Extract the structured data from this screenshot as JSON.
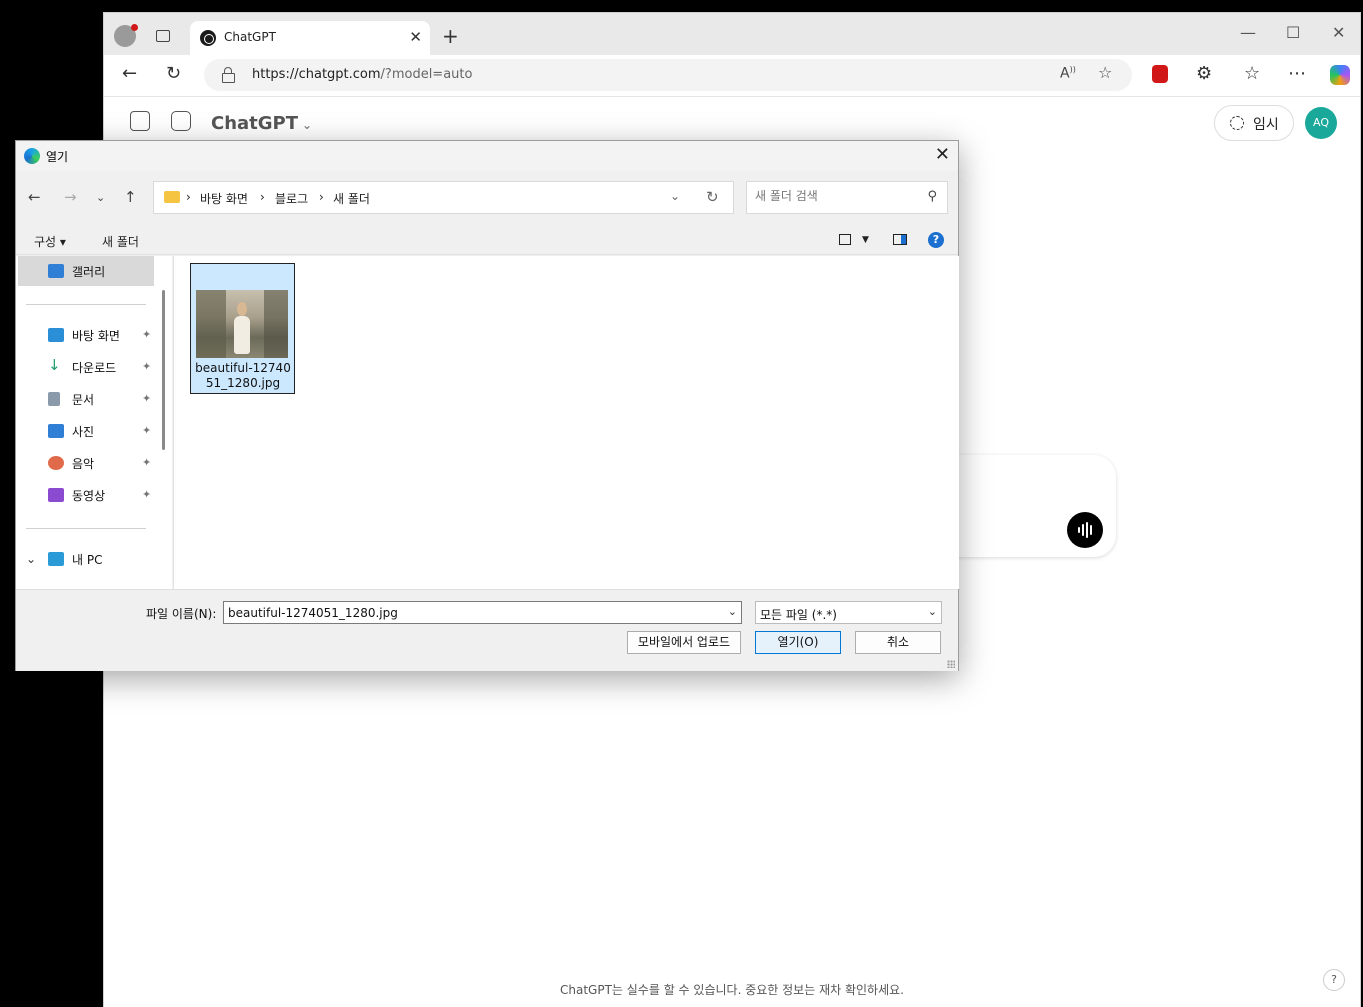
{
  "browser": {
    "tab_title": "ChatGPT",
    "url_host": "https://chatgpt.com",
    "url_rest": "/?model=auto",
    "window_controls": [
      "—",
      "☐",
      "✕"
    ]
  },
  "chatgpt": {
    "title": "ChatGPT",
    "temp_label": "임시",
    "avatar": "AQ",
    "disclaimer": "ChatGPT는 실수를 할 수 있습니다. 중요한 정보는 재차 확인하세요.",
    "help": "?"
  },
  "dialog": {
    "title": "열기",
    "breadcrumbs": [
      "바탕 화면",
      "블로그",
      "새 폴더"
    ],
    "search_placeholder": "새 폴더 검색",
    "cmd_organize": "구성 ▾",
    "cmd_new_folder": "새 폴더",
    "help": "?",
    "nav": {
      "gallery": "갤러리",
      "items": [
        {
          "label": "바탕 화면",
          "color": "#2b8fd8"
        },
        {
          "label": "다운로드",
          "color": "#1e9e6a"
        },
        {
          "label": "문서",
          "color": "#6b7b8c"
        },
        {
          "label": "사진",
          "color": "#2f7fd6"
        },
        {
          "label": "음악",
          "color": "#e06a4a"
        },
        {
          "label": "동영상",
          "color": "#8a4bd0"
        }
      ],
      "pc": "내 PC"
    },
    "file": {
      "name": "beautiful-1274051_1280.jpg",
      "name_line1": "beautiful-12740",
      "name_line2": "51_1280.jpg"
    },
    "filename_label": "파일 이름(N):",
    "filename_value": "beautiful-1274051_1280.jpg",
    "filetype_value": "모든 파일 (*.*)",
    "btn_mobile": "모바일에서 업로드",
    "btn_open": "열기(O)",
    "btn_cancel": "취소"
  }
}
